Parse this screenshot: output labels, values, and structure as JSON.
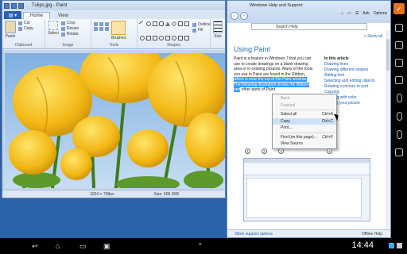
{
  "paint": {
    "title": "Tulips.jpg - Paint",
    "menu_button": "▤ ▾",
    "tabs": [
      "Home",
      "View"
    ],
    "ribbon": {
      "paste": "Paste",
      "cut": "Cut",
      "copy": "Copy",
      "select": "Select",
      "crop": "Crop",
      "resize": "Resize",
      "rotate": "Rotate",
      "brushes": "Brushes",
      "shapes_outline": "Outline",
      "shapes_fill": "Fill",
      "size": "Size",
      "groups": [
        "Clipboard",
        "Image",
        "Tools",
        "Shapes"
      ]
    },
    "status": {
      "dimensions": "1024 × 768px",
      "size": "Size: 606.3KB"
    }
  },
  "help": {
    "window_title": "Windows Help and Support",
    "search_placeholder": "Search Help",
    "toolbar": {
      "ask": "Ask",
      "options": "Options"
    },
    "show_all": "+ Show all",
    "heading": "Using Paint",
    "intro_plain": "Paint is a feature in Windows 7 that you can use to create drawings on a blank drawing area or in existing pictures. Many of the tools you use in Paint are found in the Ribbon,",
    "intro_highlight": "which is near the top of the Paint window. The following illustration shows the Ribbon and",
    "intro_tail": "other parts of Paint.",
    "toc_title": "In this article",
    "toc": [
      "Drawing lines",
      "Drawing different shapes",
      "Adding text",
      "Selecting and editing objects",
      "Rotating a picture or part",
      "Copying",
      "Working with color",
      "Viewing your picture",
      "Saving"
    ],
    "context_menu": [
      {
        "label": "Back",
        "shortcut": "",
        "disabled": true
      },
      {
        "label": "Forward",
        "shortcut": "",
        "disabled": true
      },
      {
        "sep": true
      },
      {
        "label": "Select all",
        "shortcut": "Ctrl+A",
        "disabled": false
      },
      {
        "label": "Copy",
        "shortcut": "Ctrl+C",
        "disabled": false,
        "selected": true
      },
      {
        "label": "Print...",
        "shortcut": "",
        "disabled": false
      },
      {
        "sep": true
      },
      {
        "label": "Find (on this page)...",
        "shortcut": "Ctrl+F",
        "disabled": false
      },
      {
        "label": "View Source",
        "shortcut": "",
        "disabled": false
      }
    ],
    "callouts": [
      "1",
      "2",
      "3",
      "4"
    ],
    "more_support": "More support options",
    "offline": "Offline Help"
  },
  "android": {
    "clock": "14:44"
  },
  "colors": {
    "desktop": "#2a63a8",
    "accent": "#2c6fb8",
    "selection": "#3399ff",
    "tulip": "#f2b815"
  }
}
